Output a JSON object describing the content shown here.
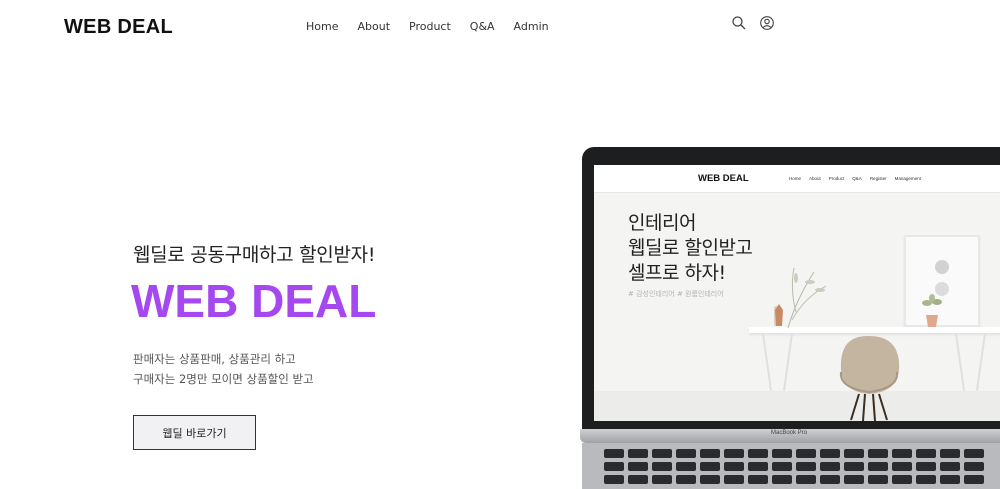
{
  "header": {
    "logo": "WEB DEAL",
    "nav": [
      "Home",
      "About",
      "Product",
      "Q&A",
      "Admin"
    ],
    "icons": [
      "search-icon",
      "user-icon"
    ]
  },
  "hero": {
    "tagline": "웹딜로 공동구매하고 할인받자!",
    "title": "WEB DEAL",
    "desc_line1": "판매자는 상품판매, 상품관리 하고",
    "desc_line2": "구매자는 2명만 모이면 상품할인 받고",
    "cta": "웹딜 바로가기"
  },
  "laptop": {
    "brand": "MacBook Pro",
    "screen": {
      "logo": "WEB DEAL",
      "nav": [
        "Home",
        "About",
        "Product",
        "Q&A",
        "Register",
        "Management"
      ],
      "headline": [
        "인테리어",
        "웹딜로 할인받고",
        "셀프로 하자!"
      ],
      "tags": "# 감성인테리어  # 원룸인테리어"
    }
  },
  "colors": {
    "accent": "#a548f0",
    "text": "#222222",
    "button_bg": "#f1f1f3"
  }
}
